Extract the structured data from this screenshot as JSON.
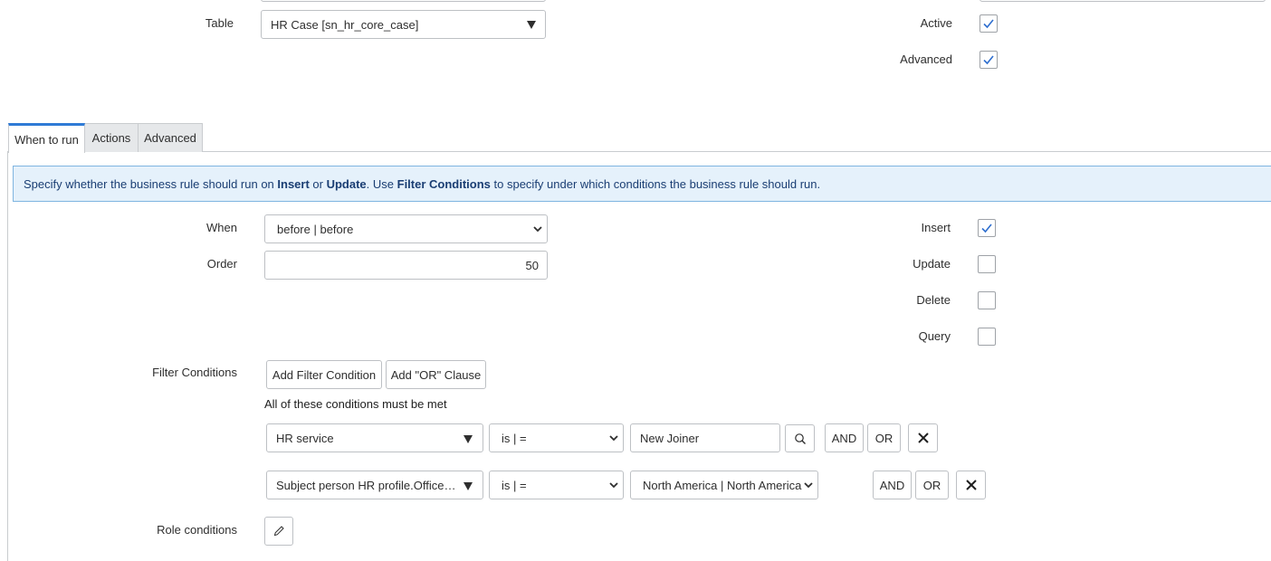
{
  "top_form": {
    "table_label": "Table",
    "table_value": "HR Case [sn_hr_core_case]",
    "active_label": "Active",
    "active_checked": true,
    "advanced_label": "Advanced",
    "advanced_checked": true
  },
  "tabs": [
    {
      "label": "When to run",
      "active": true
    },
    {
      "label": "Actions",
      "active": false
    },
    {
      "label": "Advanced",
      "active": false
    }
  ],
  "info": {
    "t1": "Specify whether the business rule should run on ",
    "insert": "Insert",
    "or": " or ",
    "update": "Update",
    "t2": ". Use ",
    "filter_conditions": "Filter Conditions",
    "t3": " to specify under which conditions the business rule should run."
  },
  "when": {
    "label": "When",
    "value": "before | before"
  },
  "order": {
    "label": "Order",
    "value": "50"
  },
  "operations": {
    "insert": {
      "label": "Insert",
      "checked": true
    },
    "update": {
      "label": "Update",
      "checked": false
    },
    "delete": {
      "label": "Delete",
      "checked": false
    },
    "query": {
      "label": "Query",
      "checked": false
    }
  },
  "filter": {
    "label": "Filter Conditions",
    "add_condition": "Add Filter Condition",
    "add_or": "Add \"OR\" Clause",
    "summary": "All of these conditions must be met",
    "rows": [
      {
        "field": "HR service",
        "operator": "is | =",
        "value": "New Joiner",
        "and": "AND",
        "or": "OR"
      },
      {
        "field": "Subject person HR profile.Office loc…",
        "operator": "is | =",
        "value": "North America | North America",
        "and": "AND",
        "or": "OR"
      }
    ]
  },
  "role": {
    "label": "Role conditions"
  },
  "colors": {
    "accent": "#1f8476",
    "info_bg": "#e5f1fb",
    "info_border": "#7fb5e0",
    "info_text": "#1a3e73",
    "check_blue": "#2f6fcf",
    "tab_bg": "#e6e8ea"
  }
}
